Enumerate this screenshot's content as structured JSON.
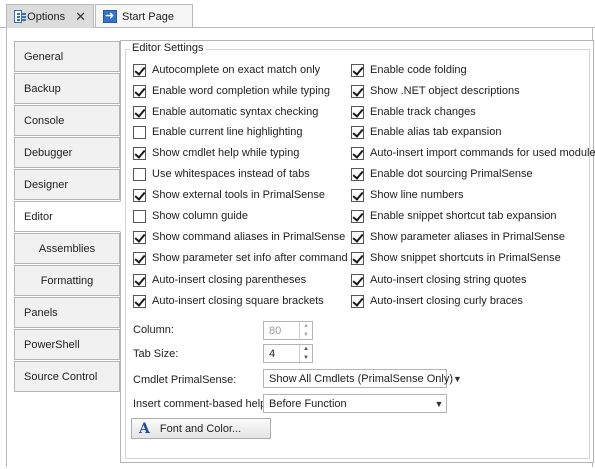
{
  "tabs": [
    {
      "label": "Options",
      "icon": "options-icon",
      "active": true,
      "close": "✕"
    },
    {
      "label": "Start Page",
      "icon": "start-page-icon",
      "active": false
    }
  ],
  "sidebar": {
    "items": [
      {
        "label": "General"
      },
      {
        "label": "Backup"
      },
      {
        "label": "Console"
      },
      {
        "label": "Debugger"
      },
      {
        "label": "Designer"
      },
      {
        "label": "Editor",
        "selected": true
      },
      {
        "label": "Assemblies",
        "sub": true
      },
      {
        "label": "Formatting",
        "sub": true
      },
      {
        "label": "Panels"
      },
      {
        "label": "PowerShell"
      },
      {
        "label": "Source Control"
      }
    ]
  },
  "editor": {
    "group_title": "Editor Settings",
    "left_options": [
      {
        "label": "Autocomplete on exact match only",
        "checked": true
      },
      {
        "label": "Enable word completion while typing",
        "checked": true
      },
      {
        "label": "Enable automatic syntax checking",
        "checked": true
      },
      {
        "label": "Enable current line highlighting",
        "checked": false
      },
      {
        "label": "Show cmdlet help while typing",
        "checked": true
      },
      {
        "label": "Use whitespaces instead of tabs",
        "checked": false
      },
      {
        "label": "Show external tools in PrimalSense",
        "checked": true
      },
      {
        "label": "Show column guide",
        "checked": false
      },
      {
        "label": "Show command aliases in PrimalSense",
        "checked": true
      },
      {
        "label": "Show parameter set info after command",
        "checked": true
      },
      {
        "label": "Auto-insert closing parentheses",
        "checked": true
      },
      {
        "label": "Auto-insert closing square brackets",
        "checked": true
      }
    ],
    "right_options": [
      {
        "label": "Enable code folding",
        "checked": true
      },
      {
        "label": "Show .NET object descriptions",
        "checked": true
      },
      {
        "label": "Enable track changes",
        "checked": true
      },
      {
        "label": "Enable alias tab expansion",
        "checked": true
      },
      {
        "label": "Auto-insert import commands for used modules",
        "checked": true
      },
      {
        "label": "Enable dot sourcing PrimalSense",
        "checked": true
      },
      {
        "label": "Show line numbers",
        "checked": true
      },
      {
        "label": "Enable snippet shortcut tab expansion",
        "checked": true
      },
      {
        "label": "Show parameter aliases in PrimalSense",
        "checked": true
      },
      {
        "label": "Show snippet shortcuts in PrimalSense",
        "checked": true
      },
      {
        "label": "Auto-insert closing string quotes",
        "checked": true
      },
      {
        "label": "Auto-insert closing curly braces",
        "checked": true
      }
    ],
    "column": {
      "label": "Column:",
      "value": "80"
    },
    "tab_size": {
      "label": "Tab Size:",
      "value": "4"
    },
    "cmdlet_primalsense": {
      "label": "Cmdlet PrimalSense:",
      "value": "Show All Cmdlets (PrimalSense Only)"
    },
    "comment_help": {
      "label": "Insert comment-based help:",
      "value": "Before Function"
    },
    "font_button": {
      "label": "Font and Color..."
    }
  }
}
